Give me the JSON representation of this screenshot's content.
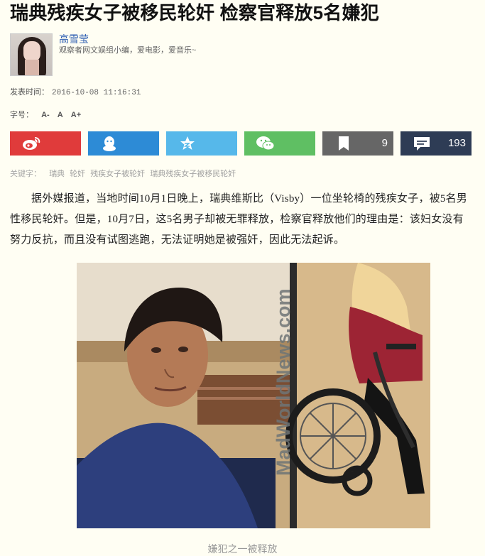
{
  "article": {
    "title": "瑞典残疾女子被移民轮奸 检察官释放5名嫌犯",
    "author": {
      "name": "高雪莹",
      "description": "观察者网文娱组小编，爱电影，爱音乐~"
    },
    "published_label": "发表时间：",
    "published_time": "2016-10-08 11:16:31",
    "font_size_label": "字号：",
    "font_size_controls": [
      "A-",
      "A",
      "A+"
    ],
    "share": {
      "bookmark_count": "9",
      "comment_count": "193",
      "colors": {
        "weibo": "#e03b3b",
        "qq": "#2d8bd6",
        "qzone": "#56b8ea",
        "wechat": "#5fbf63",
        "bookmark": "#666666",
        "comment": "#2e3c55"
      },
      "icons": [
        "weibo-icon",
        "qq-icon",
        "qzone-icon",
        "wechat-icon",
        "bookmark-icon",
        "comment-icon"
      ]
    },
    "keywords_label": "关键字：",
    "keywords": [
      "瑞典",
      "轮奸",
      "残疾女子被轮奸",
      "瑞典残疾女子被移民轮奸"
    ],
    "body": "据外媒报道，当地时间10月1日晚上，瑞典维斯比（Visby）一位坐轮椅的残疾女子，被5名男性移民轮奸。但是，10月7日，这5名男子却被无罪释放，检察官释放他们的理由是：该妇女没有努力反抗，而且没有试图逃跑，无法证明她是被强奸，因此无法起诉。",
    "image": {
      "watermark": "MadWorldNews.com"
    },
    "caption": "嫌犯之一被释放"
  }
}
